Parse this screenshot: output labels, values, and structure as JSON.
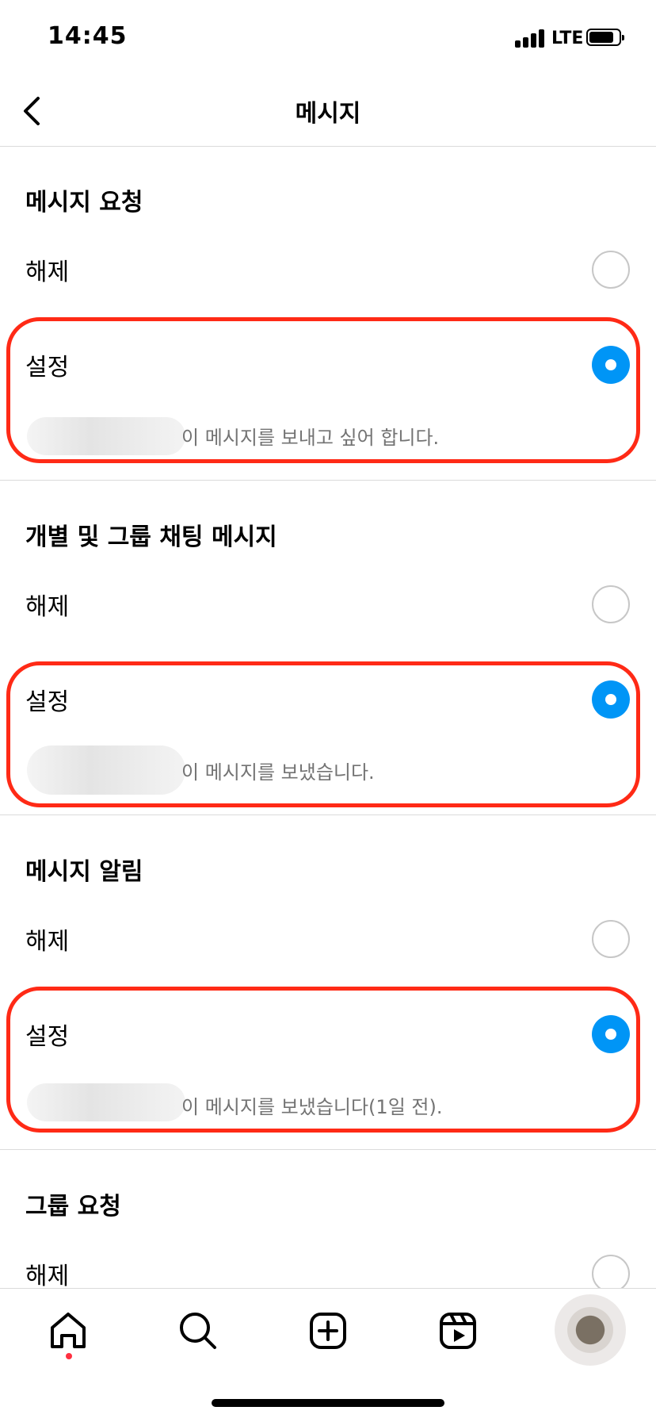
{
  "status_bar": {
    "time": "14:45",
    "network": "LTE"
  },
  "header": {
    "title": "메시지"
  },
  "sections": [
    {
      "title": "메시지 요청",
      "off_label": "해제",
      "on_label": "설정",
      "selected": "설정",
      "preview": "이 메시지를 보내고 싶어 합니다."
    },
    {
      "title": "개별 및 그룹 채팅 메시지",
      "off_label": "해제",
      "on_label": "설정",
      "selected": "설정",
      "preview": "이 메시지를 보냈습니다."
    },
    {
      "title": "메시지 알림",
      "off_label": "해제",
      "on_label": "설정",
      "selected": "설정",
      "preview": "이 메시지를 보냈습니다(1일 전)."
    },
    {
      "title": "그룹 요청",
      "off_label": "해제"
    }
  ],
  "nav": {
    "icons": [
      "home-icon",
      "search-icon",
      "create-icon",
      "reels-icon",
      "profile-avatar"
    ],
    "active": "home-icon"
  },
  "colors": {
    "accent": "#0095f6",
    "highlight": "#ff2a16",
    "notification_dot": "#ff3040"
  }
}
